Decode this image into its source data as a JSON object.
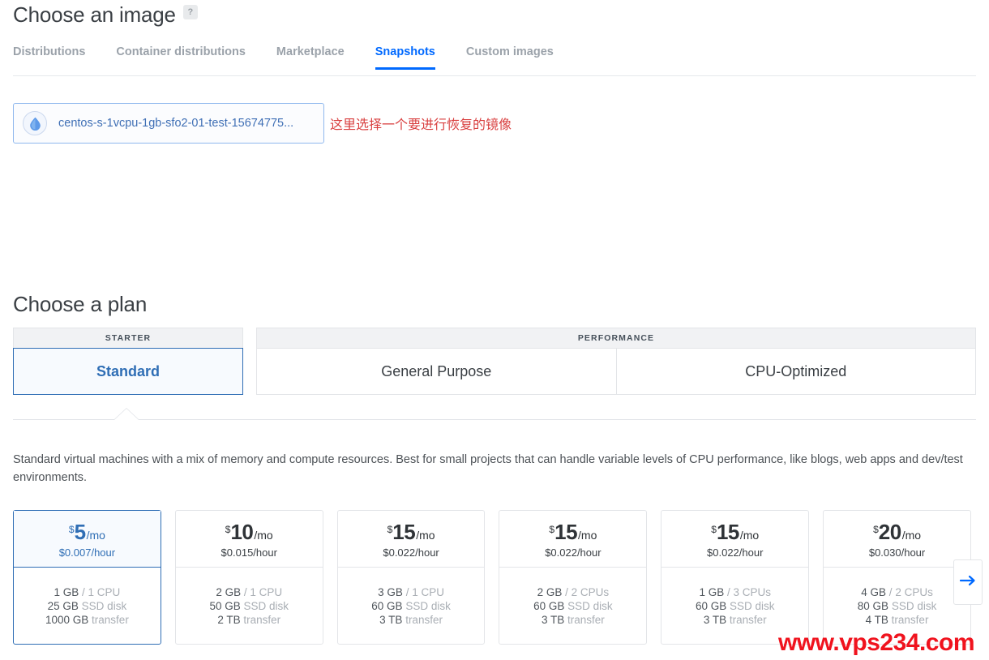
{
  "image_section": {
    "title": "Choose an image",
    "help_icon_label": "?",
    "tabs": [
      {
        "label": "Distributions",
        "active": false
      },
      {
        "label": "Container distributions",
        "active": false
      },
      {
        "label": "Marketplace",
        "active": false
      },
      {
        "label": "Snapshots",
        "active": true
      },
      {
        "label": "Custom images",
        "active": false
      }
    ],
    "snapshot": {
      "name": "centos-s-1vcpu-1gb-sfo2-01-test-15674775...",
      "icon": "droplet-icon",
      "selected": true
    },
    "annotation": "这里选择一个要进行恢复的镜像",
    "annotation_color": "#d94040"
  },
  "plan_section": {
    "title": "Choose a plan",
    "groups": [
      {
        "heading": "STARTER",
        "tabs": [
          {
            "label": "Standard",
            "selected": true
          }
        ]
      },
      {
        "heading": "PERFORMANCE",
        "tabs": [
          {
            "label": "General Purpose",
            "selected": false
          },
          {
            "label": "CPU-Optimized",
            "selected": false
          }
        ]
      }
    ],
    "description": "Standard virtual machines with a mix of memory and compute resources. Best for small projects that can handle variable levels of CPU performance, like blogs, web apps and dev/test environments.",
    "next_arrow_icon": "arrow-right-icon",
    "plans": [
      {
        "currency": "$",
        "amount": "5",
        "per": "/mo",
        "hourly": "$0.007/hour",
        "memory": "1 GB",
        "cpu": "1 CPU",
        "disk_size": "25 GB",
        "disk_label": "SSD disk",
        "transfer_size": "1000 GB",
        "transfer_label": "transfer",
        "selected": true
      },
      {
        "currency": "$",
        "amount": "10",
        "per": "/mo",
        "hourly": "$0.015/hour",
        "memory": "2 GB",
        "cpu": "1 CPU",
        "disk_size": "50 GB",
        "disk_label": "SSD disk",
        "transfer_size": "2 TB",
        "transfer_label": "transfer",
        "selected": false
      },
      {
        "currency": "$",
        "amount": "15",
        "per": "/mo",
        "hourly": "$0.022/hour",
        "memory": "3 GB",
        "cpu": "1 CPU",
        "disk_size": "60 GB",
        "disk_label": "SSD disk",
        "transfer_size": "3 TB",
        "transfer_label": "transfer",
        "selected": false
      },
      {
        "currency": "$",
        "amount": "15",
        "per": "/mo",
        "hourly": "$0.022/hour",
        "memory": "2 GB",
        "cpu": "2 CPUs",
        "disk_size": "60 GB",
        "disk_label": "SSD disk",
        "transfer_size": "3 TB",
        "transfer_label": "transfer",
        "selected": false
      },
      {
        "currency": "$",
        "amount": "15",
        "per": "/mo",
        "hourly": "$0.022/hour",
        "memory": "1 GB",
        "cpu": "3 CPUs",
        "disk_size": "60 GB",
        "disk_label": "SSD disk",
        "transfer_size": "3 TB",
        "transfer_label": "transfer",
        "selected": false
      },
      {
        "currency": "$",
        "amount": "20",
        "per": "/mo",
        "hourly": "$0.030/hour",
        "memory": "4 GB",
        "cpu": "2 CPUs",
        "disk_size": "80 GB",
        "disk_label": "SSD disk",
        "transfer_size": "4 TB",
        "transfer_label": "transfer",
        "selected": false
      }
    ]
  },
  "watermark": {
    "text": "www.vps234.com",
    "color": "#f0131e"
  },
  "colors": {
    "accent": "#0069ff",
    "selected_border": "#2f6eb5",
    "muted_text": "#a9aeb4"
  }
}
